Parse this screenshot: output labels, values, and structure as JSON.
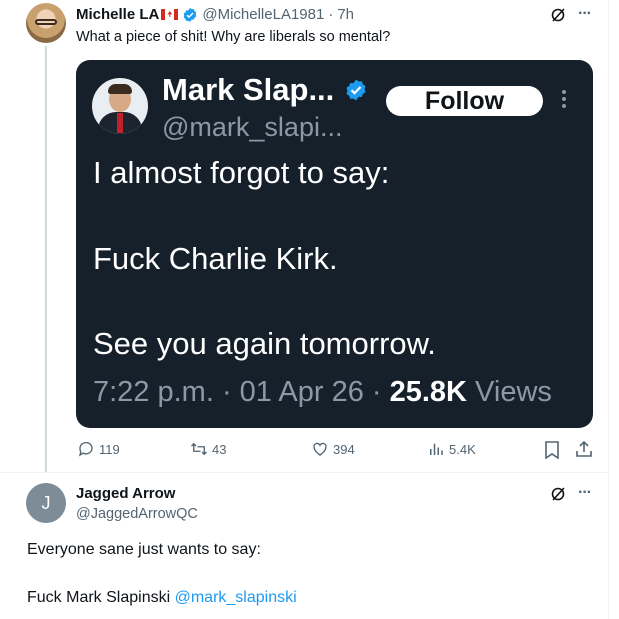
{
  "tweet1": {
    "author_name": "Michelle LA",
    "flag_icon": "canada-flag-icon",
    "handle": "@MichelleLA1981",
    "time": "7h",
    "separator": "·",
    "text": "What a piece of shit! Why are liberals so mental?",
    "more_label": "···",
    "quoted_card": {
      "name": "Mark Slap...",
      "handle": "@mark_slapi...",
      "follow_label": "Follow",
      "line1": "I almost forgot to say:",
      "line2": "Fuck Charlie Kirk.",
      "line3": "See you again tomorrow.",
      "meta_time": "7:22 p.m. · 01 Apr 26 · ",
      "views_count": "25.8K",
      "views_label": " Views",
      "colors": {
        "background": "#15202b",
        "text": "#ffffff",
        "muted": "#8b98a5"
      }
    },
    "actions": {
      "replies": "119",
      "retweets": "43",
      "likes": "394",
      "views": "5.4K"
    }
  },
  "tweet2": {
    "avatar_letter": "J",
    "author_name": "Jagged Arrow",
    "handle": "@JaggedArrowQC",
    "more_label": "···",
    "line1": "Everyone sane just wants to say:",
    "line2_text": "Fuck Mark Slapinski ",
    "line2_mention": "@mark_slapinski"
  },
  "colors": {
    "accent": "#1d9bf0",
    "muted": "#536471",
    "thread_line": "#cfd9de"
  }
}
